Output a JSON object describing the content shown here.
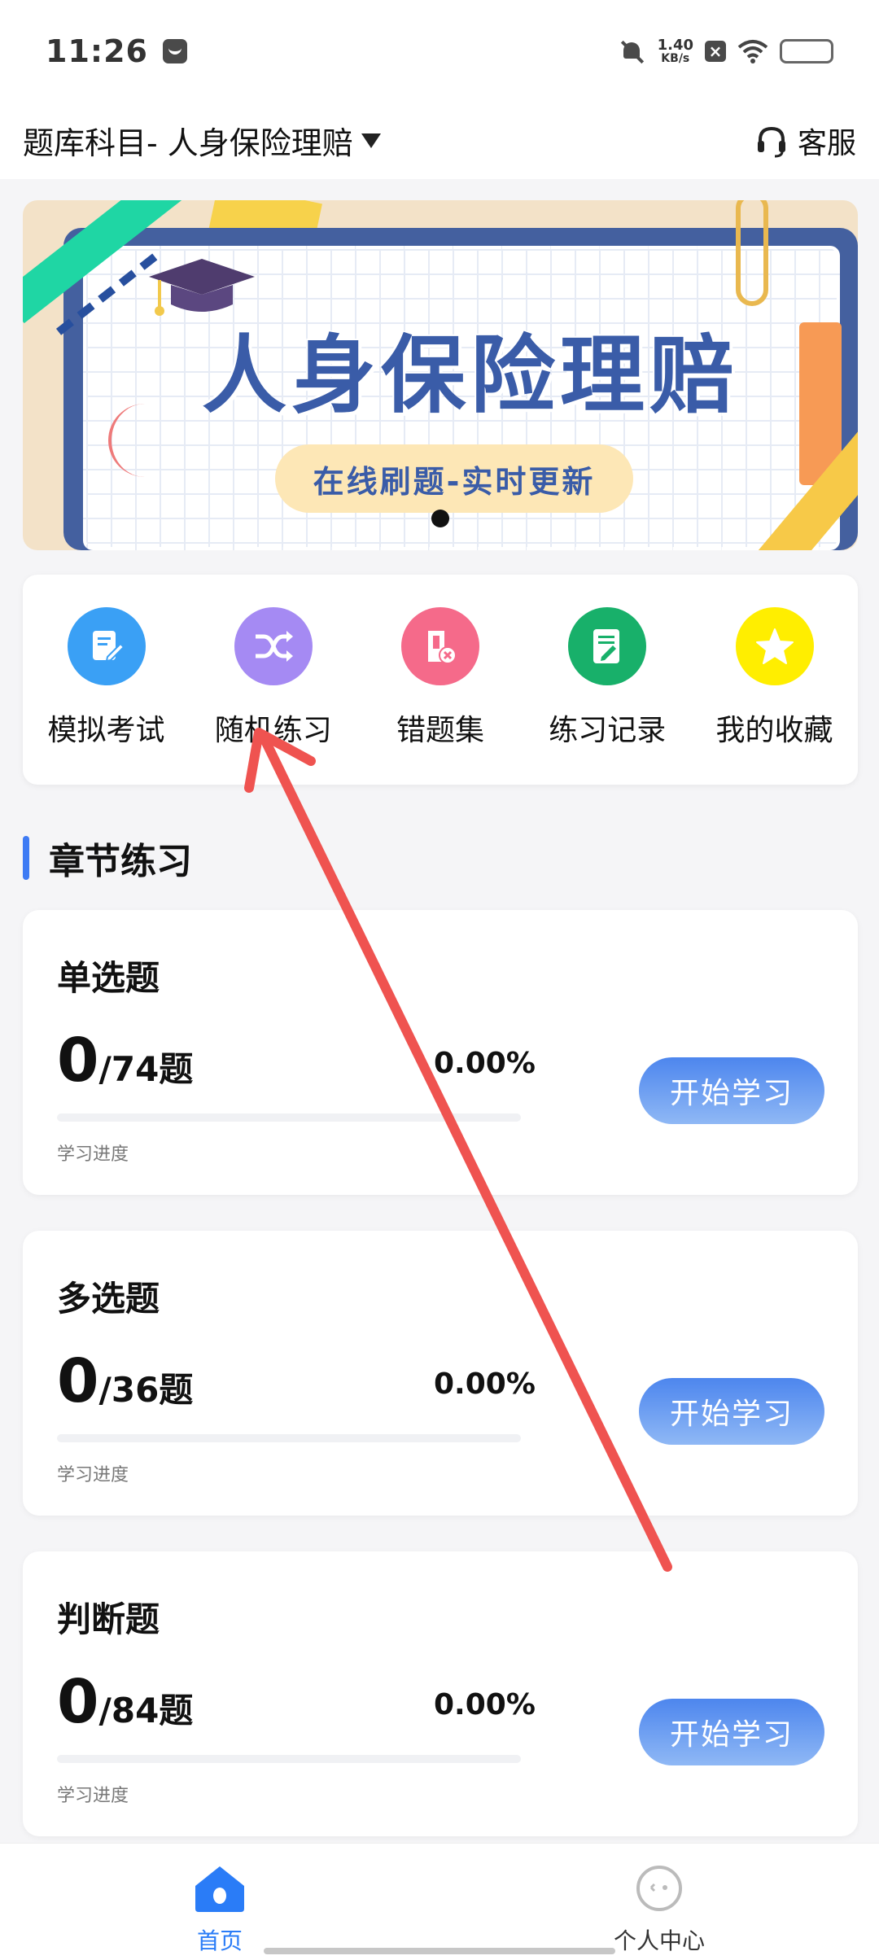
{
  "status_bar": {
    "time": "11:26",
    "net_speed_value": "1.40",
    "net_speed_unit": "KB/s",
    "icons": [
      "message-icon",
      "bell-mute-icon",
      "close-box-icon",
      "wifi-icon",
      "battery-icon"
    ]
  },
  "header": {
    "subject": "题库科目- 人身保险理赔",
    "service_label": "客服"
  },
  "banner": {
    "title": "人身保险理赔",
    "subtitle": "在线刷题-实时更新"
  },
  "quick_actions": [
    {
      "label": "模拟考试",
      "icon": "exam-icon",
      "color": "#3aa0f5"
    },
    {
      "label": "随机练习",
      "icon": "shuffle-icon",
      "color": "#a58af3"
    },
    {
      "label": "错题集",
      "icon": "wrong-set-icon",
      "color": "#f56a8a"
    },
    {
      "label": "练习记录",
      "icon": "record-icon",
      "color": "#18b06a"
    },
    {
      "label": "我的收藏",
      "icon": "star-icon",
      "color": "#ffee00"
    }
  ],
  "section": {
    "title": "章节练习"
  },
  "cards": [
    {
      "title": "单选题",
      "done": "0",
      "total": "/74题",
      "percent": "0.00%",
      "progress": 0,
      "progress_label": "学习进度",
      "button": "开始学习"
    },
    {
      "title": "多选题",
      "done": "0",
      "total": "/36题",
      "percent": "0.00%",
      "progress": 0,
      "progress_label": "学习进度",
      "button": "开始学习"
    },
    {
      "title": "判断题",
      "done": "0",
      "total": "/84题",
      "percent": "0.00%",
      "progress": 0,
      "progress_label": "学习进度",
      "button": "开始学习"
    }
  ],
  "bottom_nav": {
    "home": "首页",
    "user": "个人中心"
  },
  "colors": {
    "accent": "#3e7bf4",
    "annotation_arrow": "#ef5350"
  }
}
